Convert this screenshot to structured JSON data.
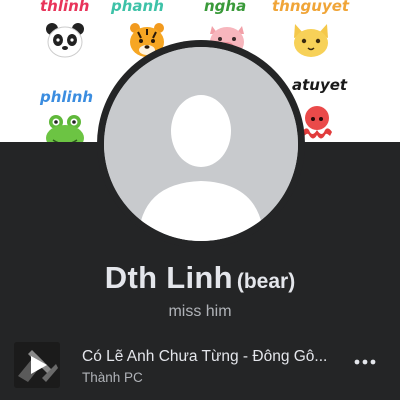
{
  "cover": {
    "stickers": [
      {
        "name": "thlinh",
        "color": "#e8345a",
        "animal": "panda-icon"
      },
      {
        "name": "phanh",
        "color": "#3ec2a8",
        "animal": "tiger-icon"
      },
      {
        "name": "ngha",
        "color": "#3a9a3a",
        "animal": "pig-icon"
      },
      {
        "name": "thnguyet",
        "color": "#f0a538",
        "animal": "cat-icon"
      },
      {
        "name": "phlinh",
        "color": "#3b8de0",
        "animal": "frog-icon"
      },
      {
        "name": "atuyet",
        "color": "#1a1a1a",
        "animal": "octopus-icon"
      }
    ]
  },
  "profile": {
    "name": "Dth Linh",
    "nickname": "(bear)",
    "bio": "miss him"
  },
  "music": {
    "title": "Có Lẽ Anh Chưa Từng - Đông Gô...",
    "artist": "Thành PC",
    "more_icon": "more-horizontal-icon"
  }
}
